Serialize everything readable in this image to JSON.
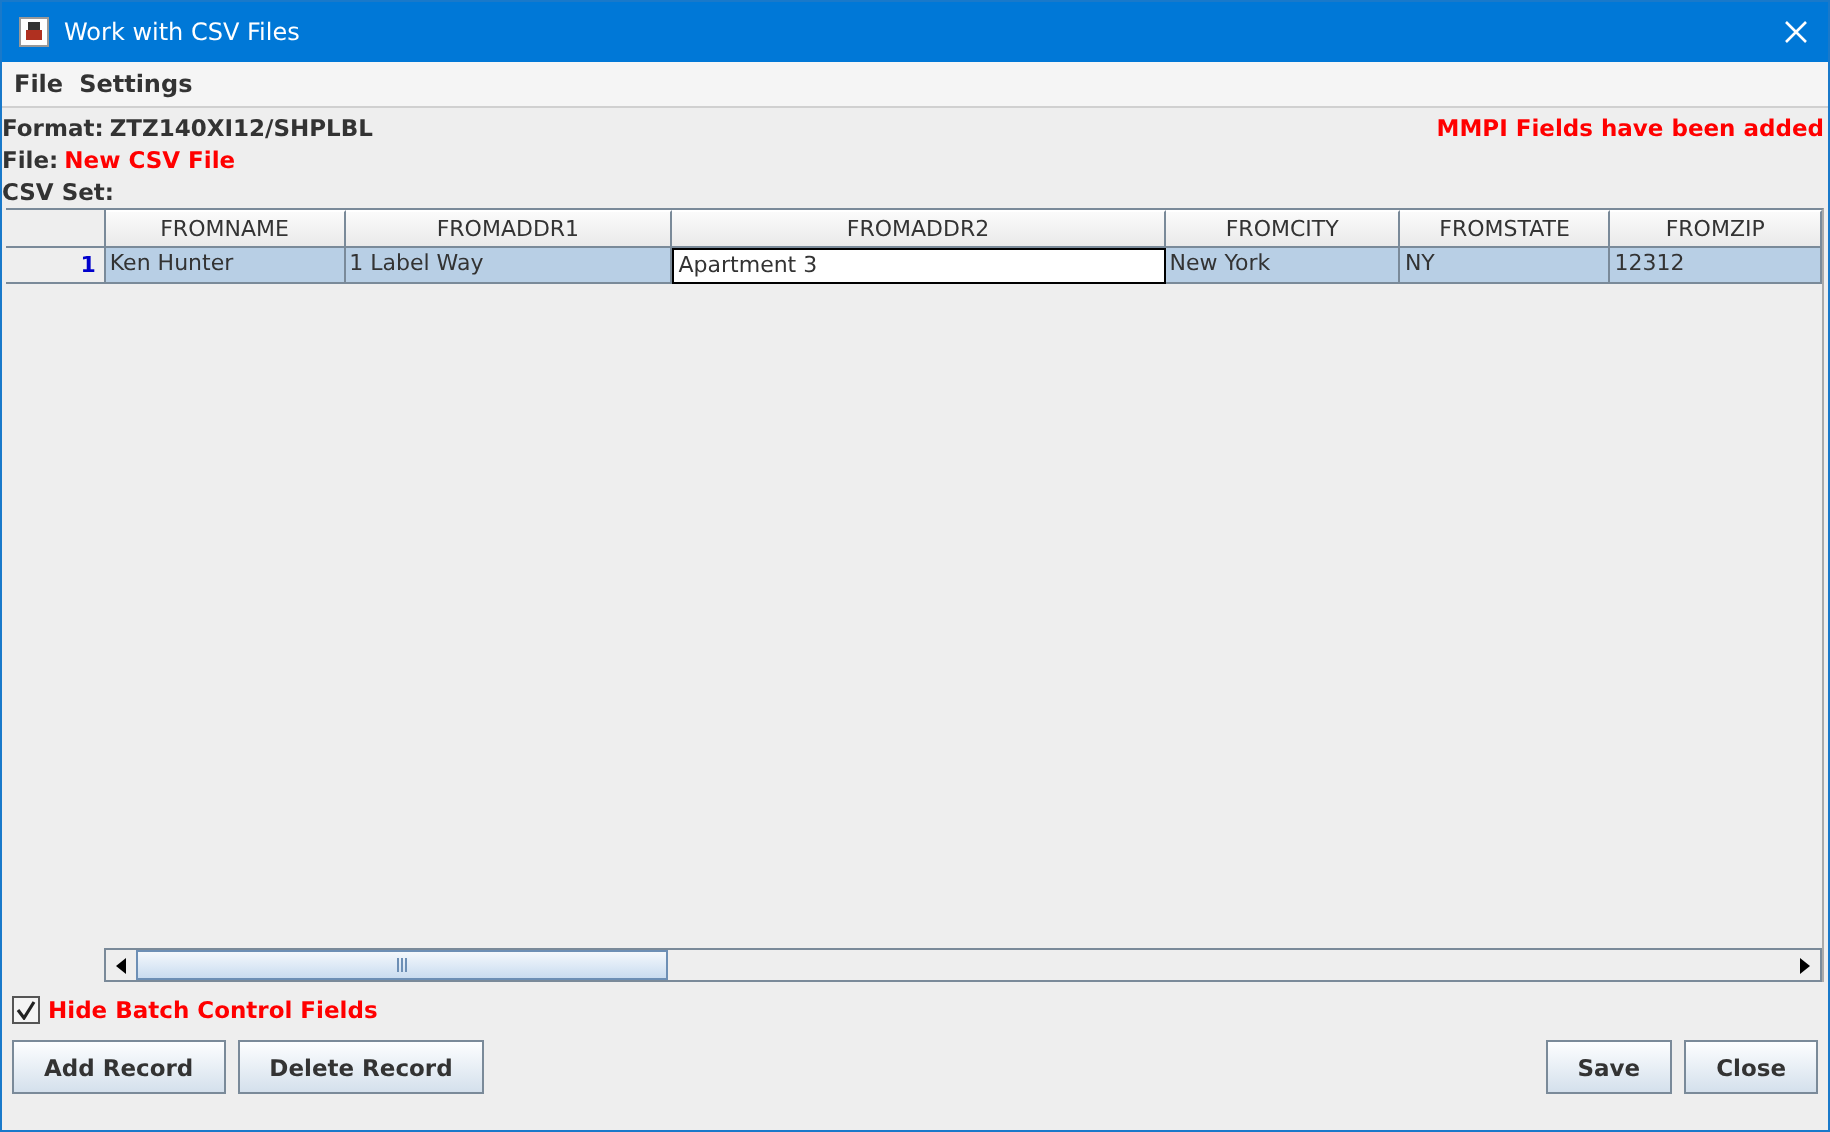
{
  "window": {
    "title": "Work with CSV Files"
  },
  "menu": [
    "File",
    "Settings"
  ],
  "info": {
    "format_label": "Format:",
    "format_value": "ZTZ140XI12/SHPLBL",
    "file_label": "File:",
    "file_value": "New CSV File",
    "set_label": "CSV Set:",
    "notice": "MMPI Fields have been added"
  },
  "table": {
    "columns": [
      "FROMNAME",
      "FROMADDR1",
      "FROMADDR2",
      "FROMCITY",
      "FROMSTATE",
      "FROMZIP"
    ],
    "rows": [
      {
        "number": "1",
        "selected": true,
        "cells": [
          {
            "text": "Ken Hunter",
            "editing": false
          },
          {
            "text": "1 Label Way",
            "editing": false
          },
          {
            "text": "Apartment 3",
            "editing": true
          },
          {
            "text": "New York",
            "editing": false
          },
          {
            "text": "NY",
            "editing": false
          },
          {
            "text": "12312",
            "editing": false
          }
        ]
      }
    ]
  },
  "hide_batch": {
    "label": "Hide Batch Control Fields",
    "checked": true
  },
  "buttons_left": [
    "Add Record",
    "Delete Record"
  ],
  "buttons_right": [
    "Save",
    "Close"
  ]
}
